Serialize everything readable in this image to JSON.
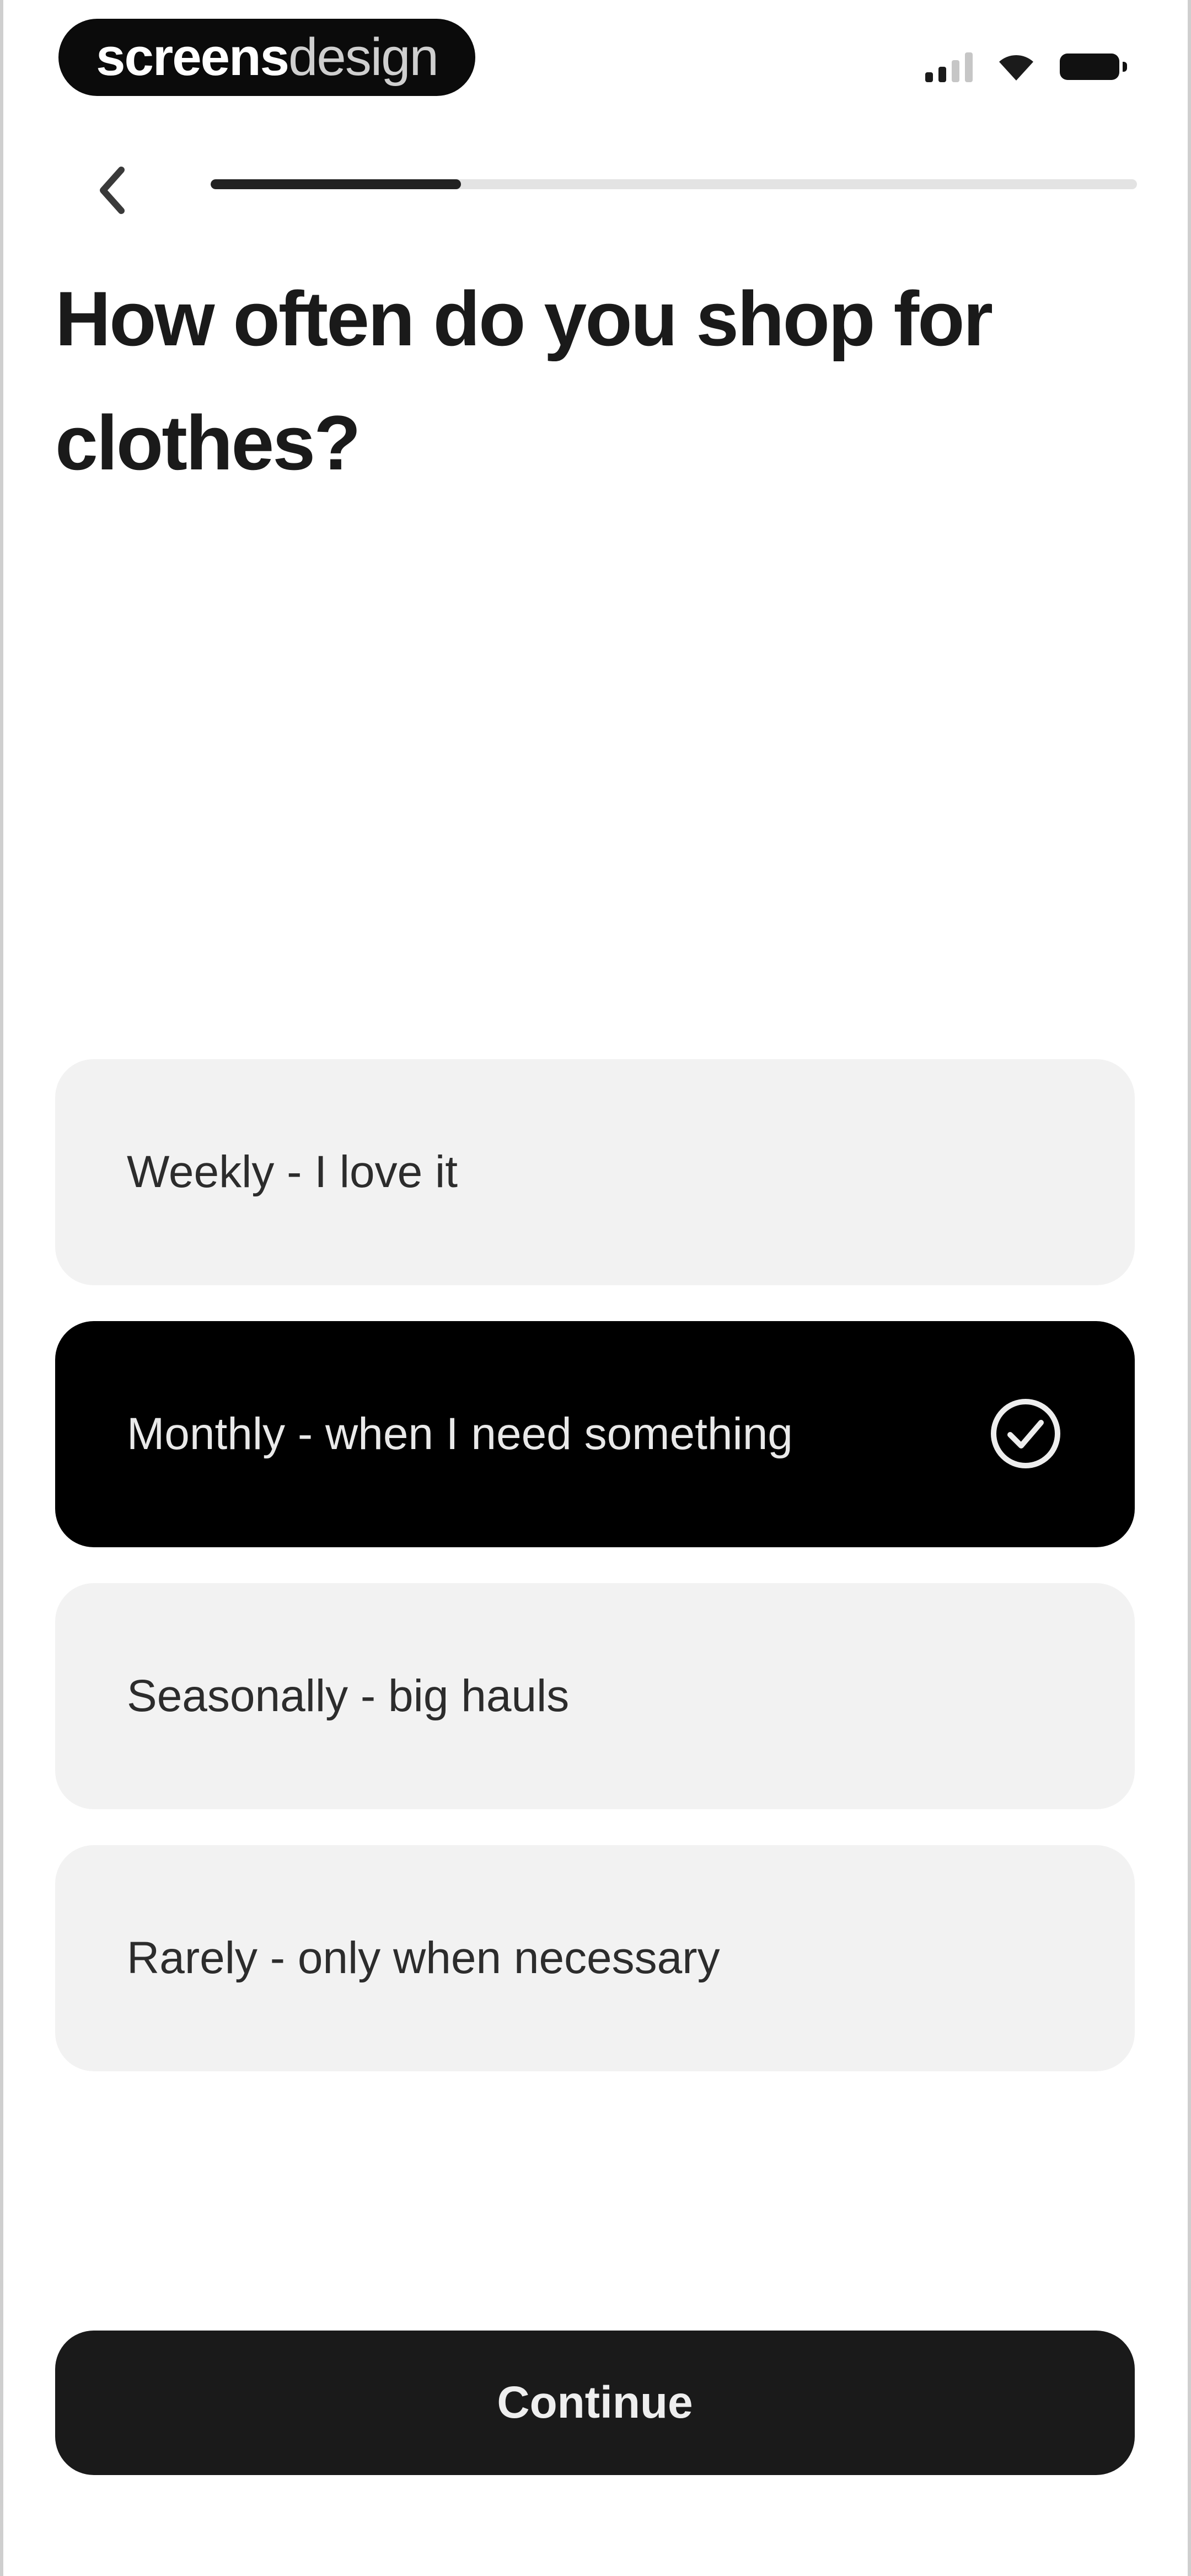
{
  "status_bar": {
    "brand_bold": "screens",
    "brand_light": "design",
    "icons": [
      "signal-icon",
      "wifi-icon",
      "battery-icon"
    ]
  },
  "header": {
    "back_icon": "chevron-left-icon",
    "progress": 0.27
  },
  "question": {
    "title": "How often do you shop for clothes?"
  },
  "options": [
    {
      "label": "Weekly - I love it",
      "selected": false
    },
    {
      "label": "Monthly - when I need something",
      "selected": true
    },
    {
      "label": "Seasonally - big hauls",
      "selected": false
    },
    {
      "label": "Rarely - only when necessary",
      "selected": false
    }
  ],
  "footer": {
    "continue_label": "Continue"
  },
  "colors": {
    "selected_bg": "#000000",
    "option_bg": "#f2f2f2",
    "button_bg": "#1a1a1a",
    "progress_fill": "#222222",
    "progress_track": "#e3e3e3"
  }
}
